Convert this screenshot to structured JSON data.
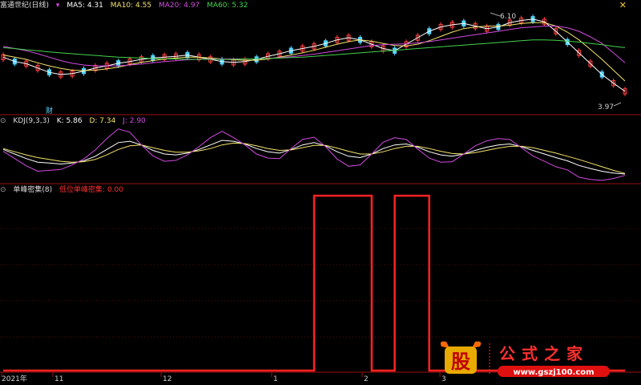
{
  "main_header": {
    "title": "富通世纪(日线)",
    "ma": [
      {
        "label": "MA5: 4.31",
        "color": "#ffffff"
      },
      {
        "label": "MA10: 4.55",
        "color": "#f5e36c"
      },
      {
        "label": "MA20: 4.97",
        "color": "#d24be0"
      },
      {
        "label": "MA60: 5.32",
        "color": "#44d24c"
      }
    ],
    "close_icon": "close-x-icon"
  },
  "kdj_header": {
    "name": "KDJ(9,3,3)",
    "k": "K: 5.86",
    "d": "D: 7.34",
    "j": "J: 2.90"
  },
  "bottom_header": {
    "name": "单峰密集(8)",
    "signal": "低位单峰密集: 0.00"
  },
  "annotations": {
    "high": "6.10",
    "low": "3.97",
    "event_marker": "财"
  },
  "date_axis": {
    "year_label": "2021年",
    "ticks": [
      "11",
      "12",
      "1",
      "2",
      "3"
    ]
  },
  "watermark": {
    "logo_char": "股",
    "brand": "公式之家",
    "url": "www.gszj100.com"
  },
  "colors": {
    "up": "#ff4040",
    "down": "#53d4ff",
    "panel_line": "#9a1010",
    "signal": "#ff2222",
    "k_line": "#ffffff",
    "d_line": "#f5e36c",
    "j_line": "#d24be0"
  },
  "chart_data": [
    {
      "type": "candlestick",
      "title": "富通世纪(日线)",
      "price_range": [
        3.97,
        6.1
      ],
      "high": 6.1,
      "low": 3.97,
      "close_ma": {
        "MA5": 4.31,
        "MA10": 4.55,
        "MA20": 4.97,
        "MA60": 5.32
      },
      "series": [
        {
          "name": "MA5",
          "values": [
            5.1,
            5.0,
            4.95,
            4.85,
            4.75,
            4.7,
            4.72,
            4.78,
            4.85,
            4.9,
            4.96,
            5.0,
            5.05,
            5.08,
            5.1,
            5.12,
            5.15,
            5.1,
            5.05,
            5.0,
            4.98,
            5.0,
            5.05,
            5.12,
            5.18,
            5.25,
            5.3,
            5.35,
            5.42,
            5.5,
            5.55,
            5.5,
            5.4,
            5.3,
            5.25,
            5.4,
            5.55,
            5.7,
            5.8,
            5.85,
            5.88,
            5.82,
            5.76,
            5.8,
            5.9,
            5.95,
            5.98,
            5.92,
            5.7,
            5.45,
            5.2,
            4.95,
            4.7,
            4.5,
            4.31
          ]
        },
        {
          "name": "MA10",
          "values": [
            5.15,
            5.1,
            5.05,
            4.97,
            4.9,
            4.84,
            4.8,
            4.79,
            4.8,
            4.83,
            4.87,
            4.93,
            4.98,
            5.02,
            5.06,
            5.08,
            5.1,
            5.1,
            5.08,
            5.06,
            5.04,
            5.03,
            5.03,
            5.06,
            5.1,
            5.15,
            5.2,
            5.26,
            5.33,
            5.4,
            5.46,
            5.5,
            5.47,
            5.42,
            5.37,
            5.36,
            5.4,
            5.48,
            5.58,
            5.68,
            5.76,
            5.8,
            5.82,
            5.82,
            5.84,
            5.88,
            5.9,
            5.9,
            5.82,
            5.68,
            5.5,
            5.28,
            5.05,
            4.8,
            4.55
          ]
        },
        {
          "name": "MA20",
          "values": [
            5.35,
            5.3,
            5.25,
            5.18,
            5.1,
            5.02,
            4.96,
            4.92,
            4.9,
            4.9,
            4.9,
            4.92,
            4.94,
            4.97,
            5.0,
            5.02,
            5.04,
            5.05,
            5.06,
            5.06,
            5.06,
            5.06,
            5.06,
            5.07,
            5.09,
            5.11,
            5.14,
            5.17,
            5.21,
            5.25,
            5.29,
            5.33,
            5.37,
            5.39,
            5.4,
            5.41,
            5.43,
            5.46,
            5.5,
            5.54,
            5.58,
            5.62,
            5.66,
            5.7,
            5.74,
            5.78,
            5.8,
            5.82,
            5.82,
            5.78,
            5.7,
            5.57,
            5.42,
            5.2,
            4.97
          ]
        },
        {
          "name": "MA60",
          "values": [
            5.32,
            5.3,
            5.27,
            5.25,
            5.22,
            5.2,
            5.18,
            5.16,
            5.14,
            5.12,
            5.1,
            5.09,
            5.08,
            5.07,
            5.06,
            5.06,
            5.05,
            5.05,
            5.05,
            5.05,
            5.05,
            5.06,
            5.06,
            5.07,
            5.08,
            5.09,
            5.1,
            5.12,
            5.14,
            5.16,
            5.18,
            5.2,
            5.22,
            5.24,
            5.26,
            5.28,
            5.3,
            5.32,
            5.34,
            5.36,
            5.38,
            5.4,
            5.42,
            5.44,
            5.46,
            5.48,
            5.5,
            5.5,
            5.49,
            5.47,
            5.45,
            5.42,
            5.39,
            5.35,
            5.32
          ]
        }
      ]
    },
    {
      "type": "line",
      "title": "KDJ(9,3,3)",
      "ylim": [
        0,
        100
      ],
      "series": [
        {
          "name": "K",
          "values": [
            60,
            50,
            40,
            32,
            30,
            28,
            30,
            35,
            45,
            60,
            75,
            78,
            70,
            58,
            50,
            48,
            52,
            60,
            70,
            80,
            78,
            72,
            62,
            55,
            52,
            60,
            70,
            75,
            68,
            55,
            45,
            42,
            50,
            62,
            70,
            72,
            65,
            55,
            48,
            45,
            50,
            58,
            65,
            70,
            72,
            66,
            58,
            50,
            42,
            35,
            25,
            18,
            12,
            8,
            5.86
          ]
        },
        {
          "name": "D",
          "values": [
            62,
            55,
            48,
            42,
            38,
            34,
            32,
            33,
            38,
            48,
            60,
            68,
            70,
            64,
            58,
            54,
            54,
            57,
            62,
            70,
            74,
            73,
            68,
            62,
            58,
            59,
            64,
            69,
            69,
            63,
            56,
            50,
            50,
            55,
            62,
            67,
            67,
            62,
            56,
            51,
            50,
            53,
            58,
            63,
            67,
            67,
            64,
            58,
            52,
            45,
            38,
            30,
            22,
            14,
            7.34
          ]
        },
        {
          "name": "J",
          "values": [
            56,
            40,
            24,
            12,
            14,
            16,
            26,
            39,
            59,
            84,
            105,
            98,
            70,
            46,
            34,
            36,
            48,
            66,
            86,
            100,
            86,
            70,
            50,
            41,
            40,
            62,
            82,
            87,
            66,
            39,
            23,
            26,
            50,
            76,
            86,
            82,
            61,
            41,
            32,
            33,
            50,
            68,
            79,
            84,
            82,
            64,
            46,
            34,
            22,
            15,
            -1,
            -6,
            -8,
            -4,
            2.9
          ]
        }
      ]
    },
    {
      "type": "line",
      "title": "单峰密集(8)",
      "series": [
        {
          "name": "低位单峰密集",
          "values": [
            0,
            0,
            0,
            0,
            0,
            0,
            0,
            0,
            0,
            0,
            0,
            0,
            0,
            0,
            0,
            0,
            0,
            0,
            0,
            0,
            0,
            0,
            0,
            0,
            0,
            0,
            0,
            1,
            1,
            1,
            1,
            1,
            0,
            0,
            1,
            1,
            1,
            0,
            0,
            0,
            0,
            0,
            0,
            0,
            0,
            0,
            0,
            0,
            0,
            0,
            0,
            0,
            0,
            0,
            0
          ]
        }
      ]
    }
  ]
}
